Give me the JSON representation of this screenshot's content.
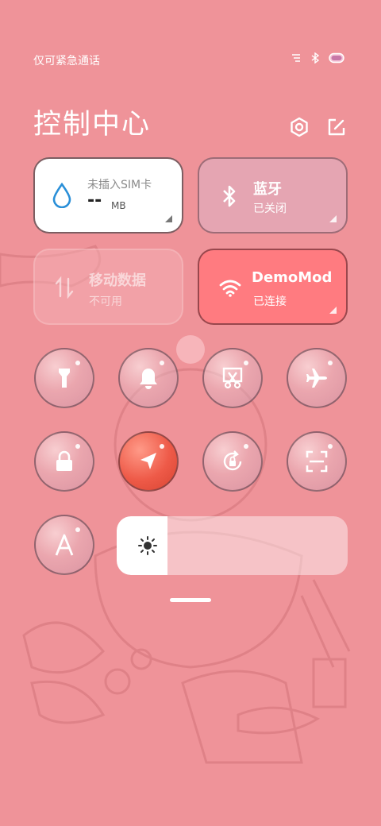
{
  "status_bar": {
    "carrier_text": "仅可紧急通话",
    "icons": [
      "signal-icon",
      "bluetooth-headset-icon",
      "battery-icon"
    ]
  },
  "title": "控制中心",
  "header_icons": [
    "settings-icon",
    "edit-icon"
  ],
  "tiles": {
    "data_usage": {
      "label": "未插入SIM卡",
      "value": "--",
      "unit": "MB"
    },
    "bluetooth": {
      "label": "蓝牙",
      "status": "已关闭"
    },
    "mobile_data": {
      "label": "移动数据",
      "status": "不可用"
    },
    "wifi": {
      "label": "DemoMod",
      "status": "已连接"
    }
  },
  "toggles": [
    {
      "name": "flashlight",
      "icon": "flashlight-icon",
      "active": false
    },
    {
      "name": "ringer",
      "icon": "bell-icon",
      "active": false
    },
    {
      "name": "screenshot",
      "icon": "scissors-icon",
      "active": false
    },
    {
      "name": "airplane-mode",
      "icon": "airplane-icon",
      "active": false
    },
    {
      "name": "lock-screen",
      "icon": "lock-icon",
      "active": false
    },
    {
      "name": "location",
      "icon": "navigation-arrow-icon",
      "active": true
    },
    {
      "name": "auto-rotate",
      "icon": "rotate-lock-icon",
      "active": false
    },
    {
      "name": "scanner",
      "icon": "scan-icon",
      "active": false
    },
    {
      "name": "auto-brightness",
      "icon": "letter-a-icon",
      "active": false
    }
  ],
  "brightness": {
    "level": 0.22,
    "icon": "sun-icon"
  },
  "colors": {
    "background": "#ef9399",
    "wifi_tile": "#ff7b80",
    "bluetooth_tile": "#e3a8b6",
    "active_toggle": "#ee5a48"
  }
}
